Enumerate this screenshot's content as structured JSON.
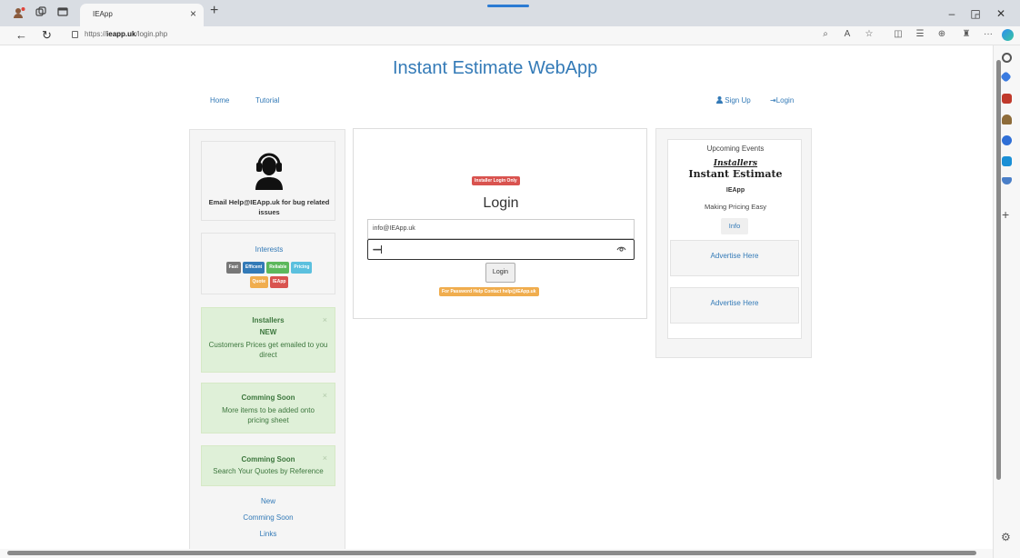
{
  "browser": {
    "tab_title": "IEApp",
    "tab_close": "×",
    "new_tab": "+",
    "url_prefix": "https://",
    "url_host": "ieapp.uk",
    "url_path": "/login.php",
    "icons": [
      "profile-icon",
      "workspaces-icon",
      "tab-actions-icon",
      "back-icon",
      "refresh-icon",
      "read-aloud-icon",
      "favorite-icon",
      "split-screen-icon",
      "favorites-icon",
      "collections-icon",
      "extensions-icon",
      "more-icon",
      "copilot-icon"
    ]
  },
  "site": {
    "title": "Instant Estimate WebApp",
    "nav": {
      "home": "Home",
      "tutorial": "Tutorial",
      "signup": "Sign Up",
      "login": "Login"
    }
  },
  "left": {
    "help_text": "Email Help@IEApp.uk for bug related issues",
    "interests_title": "Interests",
    "tags": [
      {
        "text": "Fast",
        "color": "#777777"
      },
      {
        "text": "Efficent",
        "color": "#337ab7"
      },
      {
        "text": "Reliable",
        "color": "#5cb85c"
      },
      {
        "text": "Pricing",
        "color": "#5bc0de"
      },
      {
        "text": "Quote",
        "color": "#f0ad4e"
      },
      {
        "text": "IEApp",
        "color": "#d9534f"
      }
    ],
    "alerts": [
      {
        "title": "Installers",
        "badge": "NEW",
        "text": "Customers Prices get emailed to you direct"
      },
      {
        "title": "Comming Soon",
        "text": "More items to be added onto pricing sheet"
      },
      {
        "title": "Comming Soon",
        "text": "Search Your Quotes by Reference"
      }
    ],
    "close_symbol": "×",
    "links": [
      "New",
      "Comming Soon",
      "Links"
    ]
  },
  "login": {
    "badge": "Installer Login Only",
    "heading": "Login",
    "email_value": "info@IEApp.uk",
    "password_value": "••••••••",
    "button": "Login",
    "help_badge": "For Password Help Contact help@IEApp.uk"
  },
  "right": {
    "events_title": "Upcoming Events",
    "installers": "Installers",
    "brand": "Instant Estimate",
    "app": "IEApp",
    "tagline": "Making Pricing Easy",
    "info_button": "Info",
    "advert_1": "Advertise Here",
    "advert_2": "Advertise Here"
  },
  "colors": {
    "link": "#337ab7",
    "danger": "#d9534f",
    "warning": "#f0ad4e",
    "success_bg": "#dff0d8"
  }
}
